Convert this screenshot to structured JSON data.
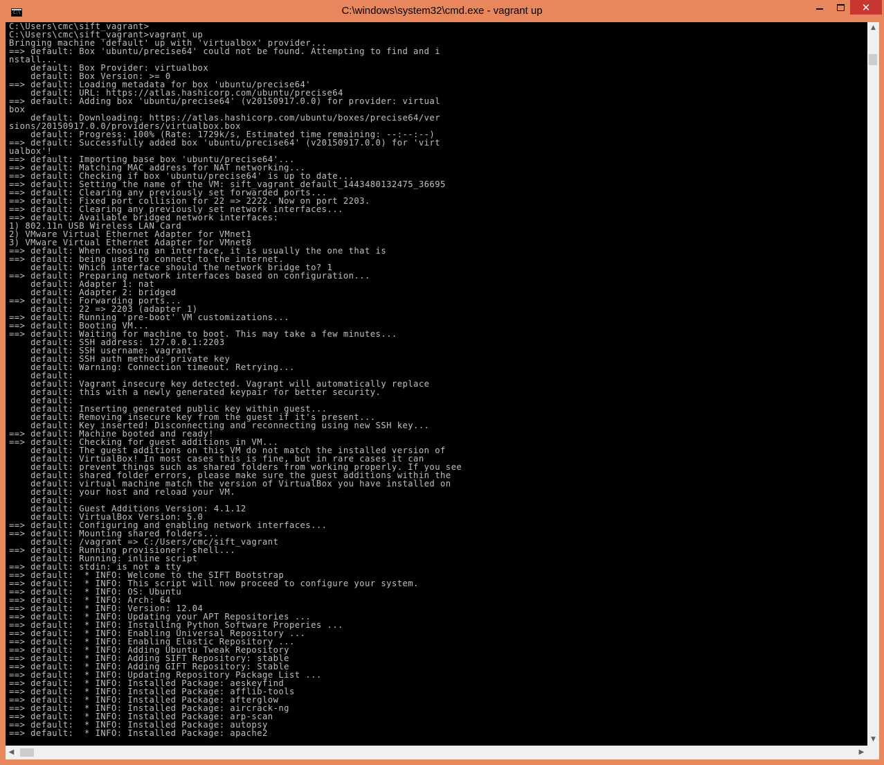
{
  "window": {
    "title": "C:\\windows\\system32\\cmd.exe - vagrant  up",
    "icon": "cmd-icon",
    "icon_glyph": "C:\\",
    "minimize_icon": "minimize-icon",
    "maximize_icon": "maximize-icon",
    "close_icon": "close-icon",
    "close_glyph": "✕"
  },
  "colors": {
    "frame": "#e8875d",
    "close_button": "#c7372f",
    "console_bg": "#000000",
    "console_text": "#c0c0c0"
  },
  "scrollbars": {
    "up_glyph": "▲",
    "down_glyph": "▼",
    "left_glyph": "◀",
    "right_glyph": "▶"
  },
  "console": {
    "lines": [
      "C:\\Users\\cmc\\sift_vagrant>",
      "C:\\Users\\cmc\\sift_vagrant>vagrant up",
      "Bringing machine 'default' up with 'virtualbox' provider...",
      "==> default: Box 'ubuntu/precise64' could not be found. Attempting to find and i",
      "nstall...",
      "    default: Box Provider: virtualbox",
      "    default: Box Version: >= 0",
      "==> default: Loading metadata for box 'ubuntu/precise64'",
      "    default: URL: https://atlas.hashicorp.com/ubuntu/precise64",
      "==> default: Adding box 'ubuntu/precise64' (v20150917.0.0) for provider: virtual",
      "box",
      "    default: Downloading: https://atlas.hashicorp.com/ubuntu/boxes/precise64/ver",
      "sions/20150917.0.0/providers/virtualbox.box",
      "    default: Progress: 100% (Rate: 1729k/s, Estimated time remaining: --:--:--)",
      "==> default: Successfully added box 'ubuntu/precise64' (v20150917.0.0) for 'virt",
      "ualbox'!",
      "==> default: Importing base box 'ubuntu/precise64'...",
      "==> default: Matching MAC address for NAT networking...",
      "==> default: Checking if box 'ubuntu/precise64' is up to date...",
      "==> default: Setting the name of the VM: sift_vagrant_default_1443480132475_36695",
      "==> default: Clearing any previously set forwarded ports...",
      "==> default: Fixed port collision for 22 => 2222. Now on port 2203.",
      "==> default: Clearing any previously set network interfaces...",
      "==> default: Available bridged network interfaces:",
      "1) 802.11n USB Wireless LAN Card",
      "2) VMware Virtual Ethernet Adapter for VMnet1",
      "3) VMware Virtual Ethernet Adapter for VMnet8",
      "==> default: When choosing an interface, it is usually the one that is",
      "==> default: being used to connect to the internet.",
      "    default: Which interface should the network bridge to? 1",
      "==> default: Preparing network interfaces based on configuration...",
      "    default: Adapter 1: nat",
      "    default: Adapter 2: bridged",
      "==> default: Forwarding ports...",
      "    default: 22 => 2203 (adapter 1)",
      "==> default: Running 'pre-boot' VM customizations...",
      "==> default: Booting VM...",
      "==> default: Waiting for machine to boot. This may take a few minutes...",
      "    default: SSH address: 127.0.0.1:2203",
      "    default: SSH username: vagrant",
      "    default: SSH auth method: private key",
      "    default: Warning: Connection timeout. Retrying...",
      "    default:",
      "    default: Vagrant insecure key detected. Vagrant will automatically replace",
      "    default: this with a newly generated keypair for better security.",
      "    default:",
      "    default: Inserting generated public key within guest...",
      "    default: Removing insecure key from the guest if it's present...",
      "    default: Key inserted! Disconnecting and reconnecting using new SSH key...",
      "==> default: Machine booted and ready!",
      "==> default: Checking for guest additions in VM...",
      "    default: The guest additions on this VM do not match the installed version of",
      "    default: VirtualBox! In most cases this is fine, but in rare cases it can",
      "    default: prevent things such as shared folders from working properly. If you see",
      "    default: shared folder errors, please make sure the guest additions within the",
      "    default: virtual machine match the version of VirtualBox you have installed on",
      "    default: your host and reload your VM.",
      "    default:",
      "    default: Guest Additions Version: 4.1.12",
      "    default: VirtualBox Version: 5.0",
      "==> default: Configuring and enabling network interfaces...",
      "==> default: Mounting shared folders...",
      "    default: /vagrant => C:/Users/cmc/sift_vagrant",
      "==> default: Running provisioner: shell...",
      "    default: Running: inline script",
      "==> default: stdin: is not a tty",
      "==> default:  * INFO: Welcome to the SIFT Bootstrap",
      "==> default:  * INFO: This script will now proceed to configure your system.",
      "==> default:  * INFO: OS: Ubuntu",
      "==> default:  * INFO: Arch: 64",
      "==> default:  * INFO: Version: 12.04",
      "==> default:  * INFO: Updating your APT Repositories ...",
      "==> default:  * INFO: Installing Python Software Properies ...",
      "==> default:  * INFO: Enabling Universal Repository ...",
      "==> default:  * INFO: Enabling Elastic Repository ...",
      "==> default:  * INFO: Adding Ubuntu Tweak Repository",
      "==> default:  * INFO: Adding SIFT Repository: stable",
      "==> default:  * INFO: Adding GIFT Repository: Stable",
      "==> default:  * INFO: Updating Repository Package List ...",
      "==> default:  * INFO: Installed Package: aeskeyfind",
      "==> default:  * INFO: Installed Package: afflib-tools",
      "==> default:  * INFO: Installed Package: afterglow",
      "==> default:  * INFO: Installed Package: aircrack-ng",
      "==> default:  * INFO: Installed Package: arp-scan",
      "==> default:  * INFO: Installed Package: autopsy",
      "==> default:  * INFO: Installed Package: apache2"
    ]
  }
}
